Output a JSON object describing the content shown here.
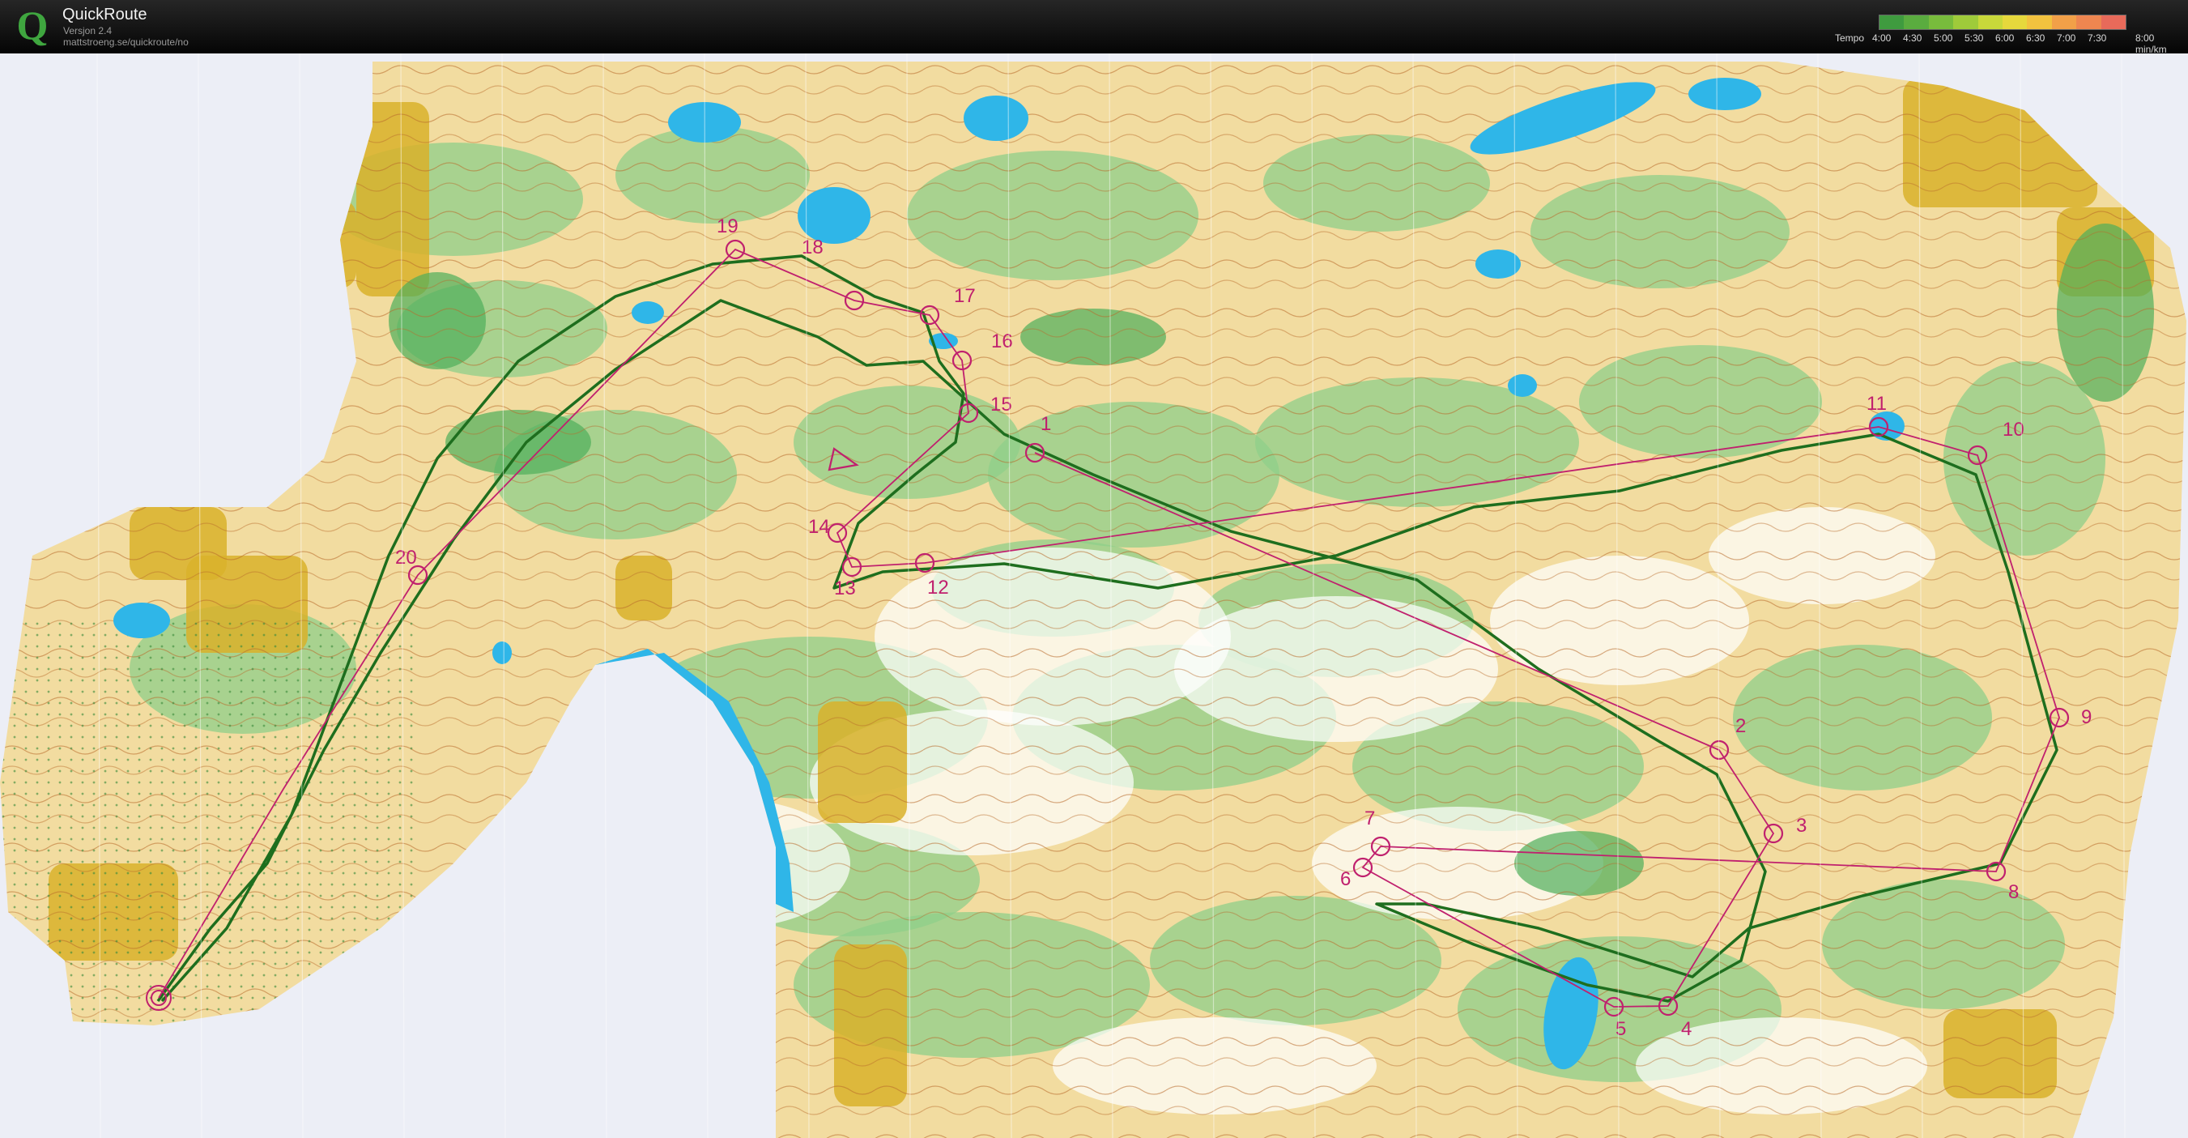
{
  "app": {
    "title": "QuickRoute",
    "version": "Versjon 2.4",
    "url": "mattstroeng.se/quickroute/no",
    "logo_letter": "Q"
  },
  "legend": {
    "label": "Tempo",
    "ticks": [
      "4:00",
      "4:30",
      "5:00",
      "5:30",
      "6:00",
      "6:30",
      "7:00",
      "7:30",
      "8:00"
    ],
    "unit": "min/km",
    "gradient_colors": [
      "#3f9b3f",
      "#5aac3f",
      "#78bc3c",
      "#9fcb3a",
      "#c8d83a",
      "#e6d83c",
      "#f2c23f",
      "#f2a048",
      "#ee8650",
      "#e86a5a"
    ]
  },
  "map": {
    "colors": {
      "open_land": "#e8c06a",
      "rough_open": "#f2dca0",
      "forest": "#ffffff",
      "green": "#8fcf8a",
      "dark_green": "#4fae5a",
      "water": "#2fb6e8",
      "field": "#d9b12a",
      "course": "#c0206e",
      "route": "#1e6e1e",
      "background": "#eceef6"
    },
    "controls": [
      {
        "label": "1"
      },
      {
        "label": "2"
      },
      {
        "label": "3"
      },
      {
        "label": "4"
      },
      {
        "label": "5"
      },
      {
        "label": "6"
      },
      {
        "label": "7"
      },
      {
        "label": "8"
      },
      {
        "label": "9"
      },
      {
        "label": "10"
      },
      {
        "label": "11"
      },
      {
        "label": "12"
      },
      {
        "label": "13"
      },
      {
        "label": "14"
      },
      {
        "label": "15"
      },
      {
        "label": "16"
      },
      {
        "label": "17"
      },
      {
        "label": "18"
      },
      {
        "label": "19"
      },
      {
        "label": "20"
      }
    ]
  }
}
